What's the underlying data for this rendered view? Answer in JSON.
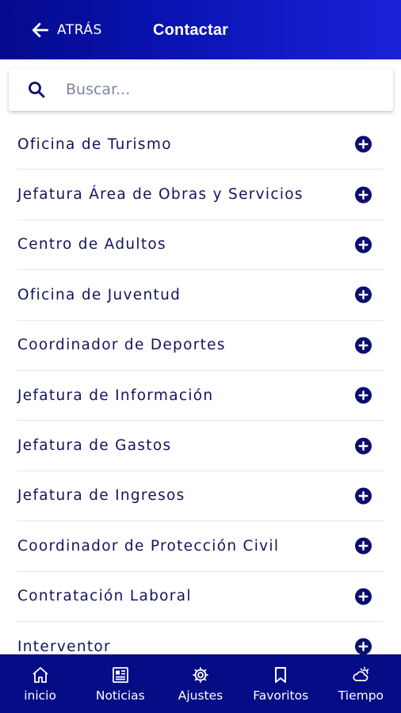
{
  "header": {
    "back_label": "ATRÁS",
    "title": "Contactar"
  },
  "search": {
    "placeholder": "Buscar..."
  },
  "contacts": [
    {
      "label": "Oficina de Turismo"
    },
    {
      "label": "Jefatura Área de Obras y Servicios"
    },
    {
      "label": "Centro de Adultos"
    },
    {
      "label": "Oficina de Juventud"
    },
    {
      "label": "Coordinador de Deportes"
    },
    {
      "label": "Jefatura de Información"
    },
    {
      "label": "Jefatura de Gastos"
    },
    {
      "label": "Jefatura de Ingresos"
    },
    {
      "label": "Coordinador de Protección Civil"
    },
    {
      "label": "Contratación Laboral"
    },
    {
      "label": "Interventor"
    }
  ],
  "bottom_nav": [
    {
      "label": "inicio",
      "icon": "home-icon"
    },
    {
      "label": "Noticias",
      "icon": "newspaper-icon"
    },
    {
      "label": "Ajustes",
      "icon": "gear-icon"
    },
    {
      "label": "Favoritos",
      "icon": "bookmark-icon"
    },
    {
      "label": "Tiempo",
      "icon": "weather-icon"
    }
  ],
  "colors": {
    "header_start": "#050a8c",
    "header_end": "#1a22d8",
    "text": "#12145e",
    "accent": "#0a0f6e",
    "nav_bg": "#050d86"
  }
}
